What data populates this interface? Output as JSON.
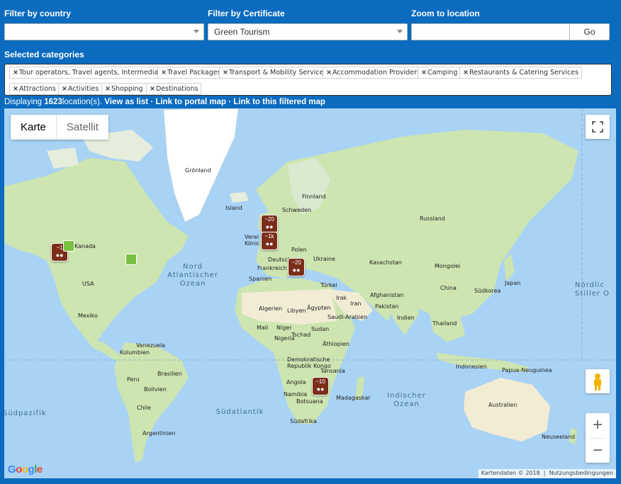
{
  "filters": {
    "country_label": "Filter by country",
    "country_value": "",
    "certificate_label": "Filter by Certificate",
    "certificate_value": "Green Tourism",
    "zoom_label": "Zoom to location",
    "zoom_value": "",
    "go_label": "Go"
  },
  "categories": {
    "label": "Selected categories",
    "remove_glyph": "×",
    "items": [
      "Tour operators, Travel agents, Intermediaries",
      "Travel Packages",
      "Transport & Mobility Services",
      "Accommodation Providers",
      "Camping",
      "Restaurants & Catering Services",
      "Attractions",
      "Activities",
      "Shopping",
      "Destinations"
    ]
  },
  "status": {
    "prefix": "Displaying ",
    "count": "1623",
    "suffix": "location(s).",
    "view_list": "View as list",
    "sep1": " · ",
    "portal_link": "Link to portal map",
    "sep2": " · ",
    "filtered_link": "Link to this filtered map"
  },
  "map": {
    "type_map": "Karte",
    "type_sat": "Satellit",
    "zoom_in": "+",
    "zoom_out": "−",
    "attribution_data": "Kartendaten © 2018",
    "attribution_terms": "Nutzungsbedingungen",
    "google_letters": [
      "G",
      "o",
      "o",
      "g",
      "l",
      "e"
    ],
    "google_colors": [
      "#4285f4",
      "#ea4335",
      "#fbbc05",
      "#4285f4",
      "#34a853",
      "#ea4335"
    ],
    "labels": {
      "groenland": "Grönland",
      "island": "Island",
      "finnland": "Finnland",
      "schweden": "Schweden",
      "russland": "Russland",
      "kanada": "Kanada",
      "usa": "USA",
      "mexiko": "Mexiko",
      "vereinigtes": "Verei",
      "koenig": "Könic",
      "deutsch": "Deutsch",
      "polen": "Polen",
      "ukraine": "Ukraine",
      "frankreich": "Frankreich",
      "spanien": "Spanien",
      "tuerkei": "Türkei",
      "kasachstan": "Kasachstan",
      "mongolei": "Mongolei",
      "china": "China",
      "japan": "Japan",
      "suedkorea": "Südkorea",
      "afghanistan": "Afghanistan",
      "pakistan": "Pakistan",
      "iran": "Iran",
      "irak": "Irak",
      "indien": "Indien",
      "thailand": "Thailand",
      "saudi": "Saudi-Arabien",
      "algerien": "Algerien",
      "libyen": "Libyen",
      "aegypten": "Ägypten",
      "mali": "Mali",
      "niger": "Niger",
      "tschad": "Tschad",
      "sudan": "Sudan",
      "nigeria": "Nigeria",
      "aethiopien": "Äthiopien",
      "kongo_dr": "Demokratische",
      "kongo_rep": "Republik Kongo",
      "tansania": "Tansania",
      "angola": "Angola",
      "namibia": "Namibia",
      "botsuana": "Botsuana",
      "madagaskar": "Madagaskar",
      "suedafrika": "Südafrika",
      "venezuela": "Venezuela",
      "kolumbien": "Kolumbien",
      "peru": "Peru",
      "brasilien": "Brasilien",
      "bolivien": "Bolivien",
      "chile": "Chile",
      "argentinien": "Argentinien",
      "indonesien": "Indonesien",
      "papua": "Papua-Neuguinea",
      "australien": "Australien",
      "neuseeland": "Neuseeland"
    },
    "oceans": {
      "nordatlantik": "Nord\nAtlantischer\nOzean",
      "suedatlantik": "Südatlantik",
      "suedpazifik": "Südpazifik",
      "indisch": "Indischer\nOzean",
      "nordpazifik": "Nördlic\nStiller O"
    },
    "markers": [
      {
        "name": "north-america",
        "count": "~1"
      },
      {
        "name": "uk-1",
        "count": "~20"
      },
      {
        "name": "uk-2",
        "count": "~1k"
      },
      {
        "name": "europe-south",
        "count": "~20"
      },
      {
        "name": "southern-africa",
        "count": "~10"
      }
    ],
    "cluster_icon": "people-icon"
  }
}
